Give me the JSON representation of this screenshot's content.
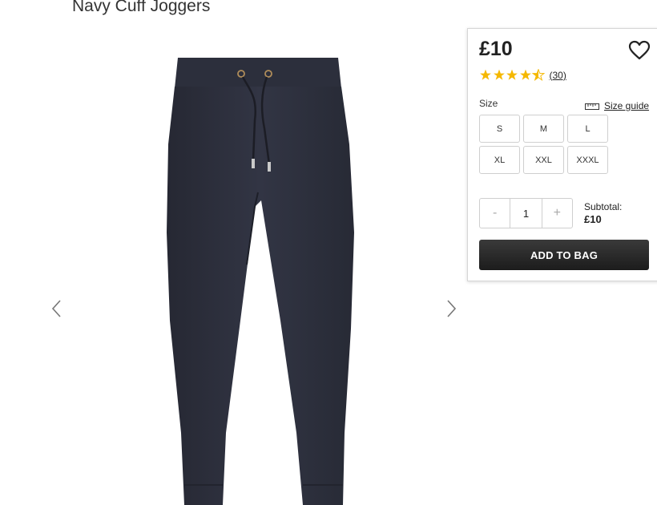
{
  "product": {
    "title": "Navy Cuff Joggers",
    "price": "£10",
    "rating": 4.5,
    "review_count": "(30)"
  },
  "gallery": {
    "prev_icon": "chevron-left-icon",
    "next_icon": "chevron-right-icon"
  },
  "size": {
    "label": "Size",
    "guide_label": "Size guide",
    "options": [
      "S",
      "M",
      "L",
      "XL",
      "XXL",
      "XXXL"
    ]
  },
  "quantity": {
    "minus": "-",
    "value": "1",
    "plus": "+"
  },
  "subtotal": {
    "label": "Subtotal:",
    "amount": "£10"
  },
  "actions": {
    "add_to_bag": "ADD TO BAG",
    "wishlist_icon": "heart-icon"
  },
  "colors": {
    "star": "#f5b800",
    "button_dark": "#222222",
    "product_fabric": "#2e3140"
  }
}
